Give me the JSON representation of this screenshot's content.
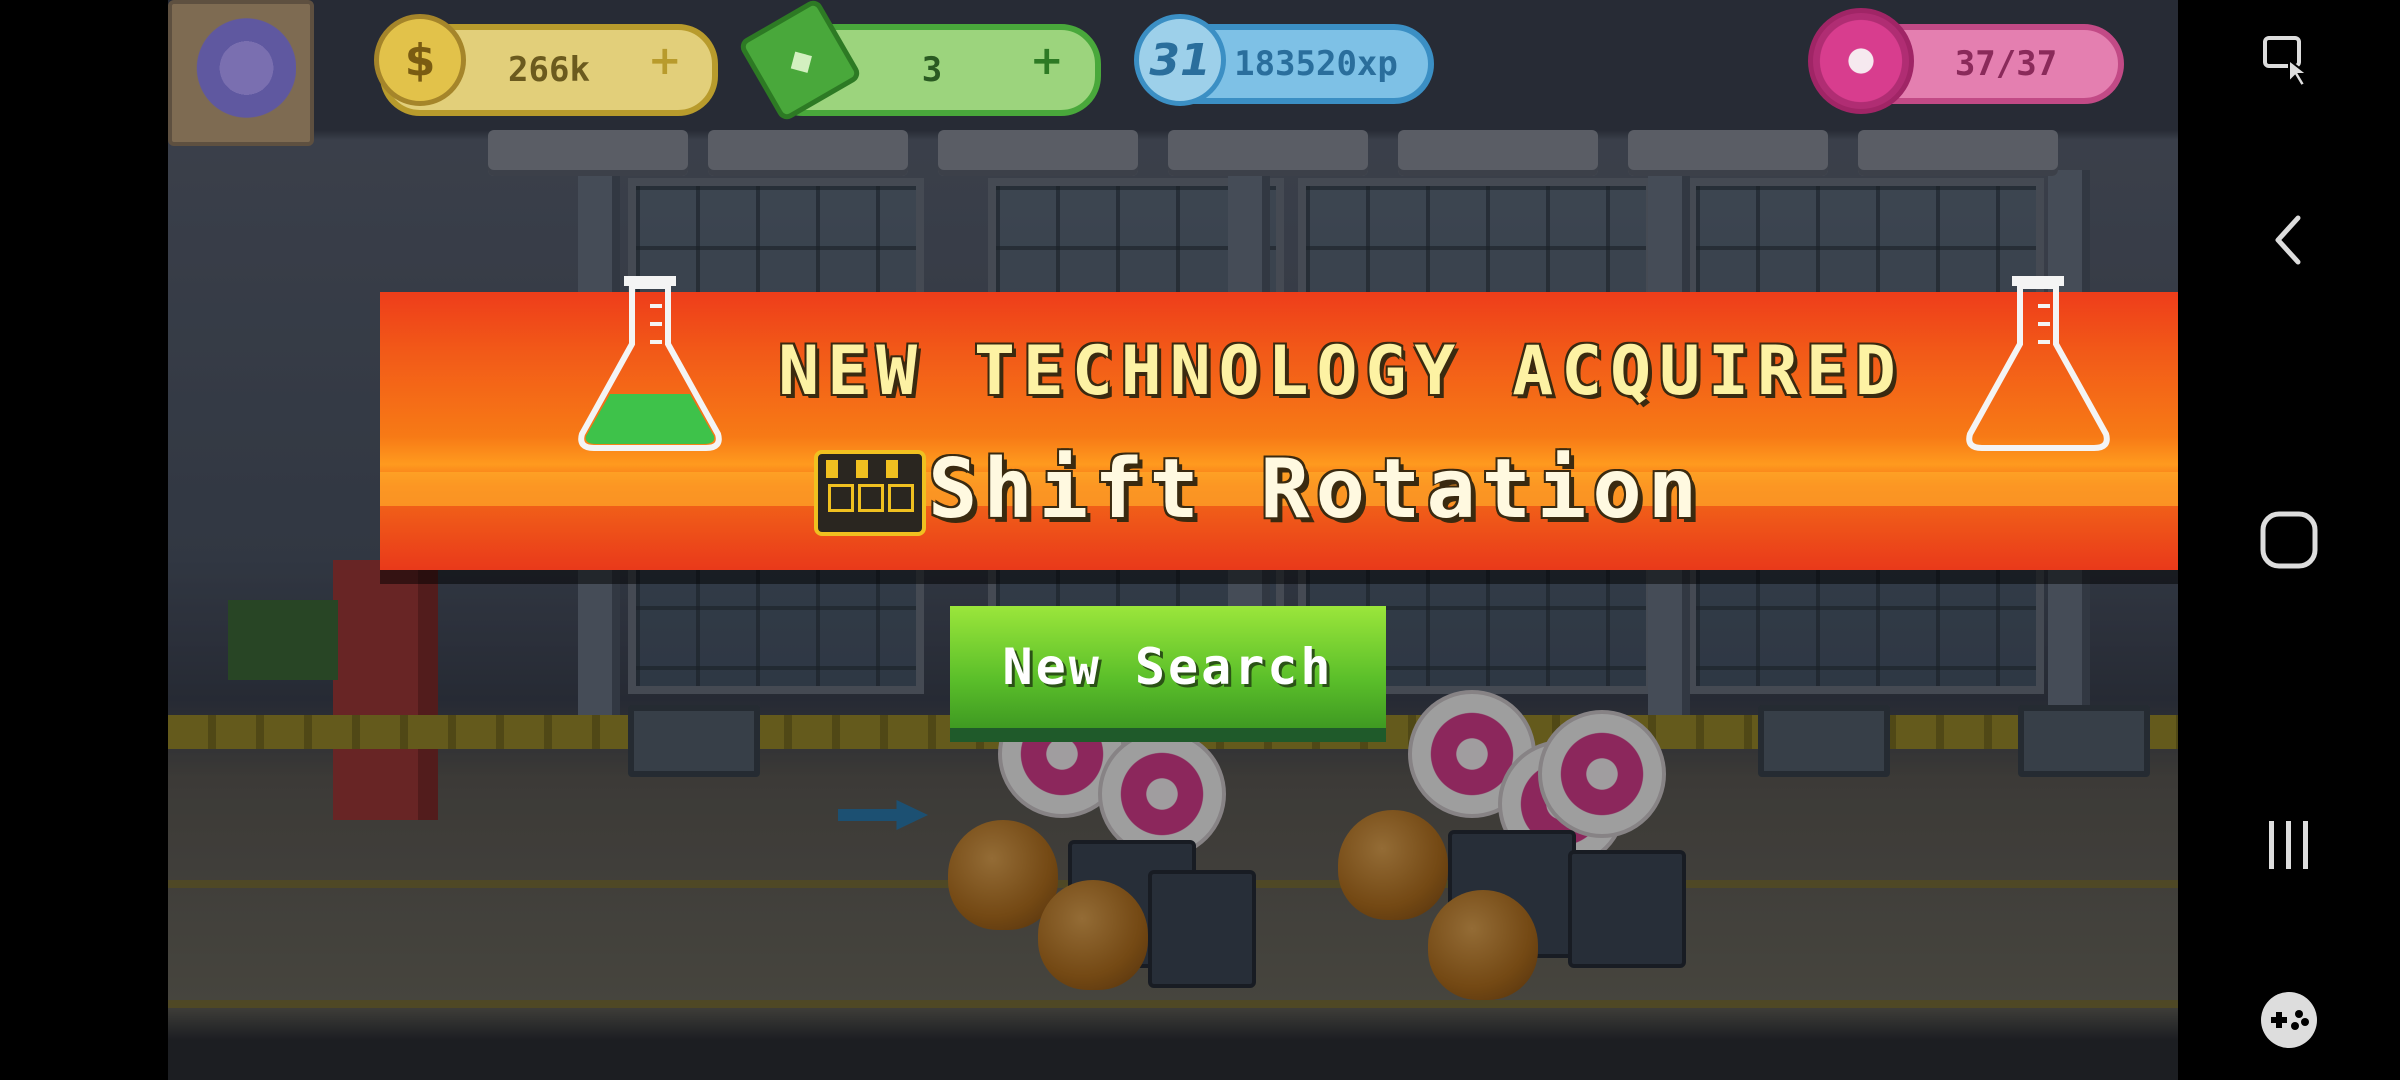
{
  "hud": {
    "coins": {
      "icon": "coin-icon",
      "value": "266k",
      "plus": "+"
    },
    "cash": {
      "icon": "cash-icon",
      "value": "3",
      "plus": "+"
    },
    "level": {
      "icon": "level-badge-icon",
      "level": "31",
      "xp": "183520xp"
    },
    "donuts": {
      "icon": "donut-icon",
      "value": "37/37"
    }
  },
  "banner": {
    "title": "NEW TECHNOLOGY ACQUIRED",
    "tech_name": "Shift Rotation",
    "tech_icon": "factory-shifts-icon",
    "flask_icons": [
      "flask-green-icon",
      "flask-empty-icon"
    ]
  },
  "actions": {
    "new_search_label": "New Search"
  },
  "system_nav": {
    "items": [
      "screen-capture-icon",
      "back-icon",
      "home-icon",
      "recents-icon",
      "game-tools-icon"
    ]
  },
  "colors": {
    "banner_red": "#ee3d1a",
    "banner_orange": "#f77a16",
    "title_yellow": "#fdf2a3",
    "button_green": "#5bbf2a",
    "coin_gold": "#e2c24a",
    "cash_green": "#49a83b",
    "xp_blue": "#4aa5d8",
    "donut_pink": "#d83d8e"
  }
}
